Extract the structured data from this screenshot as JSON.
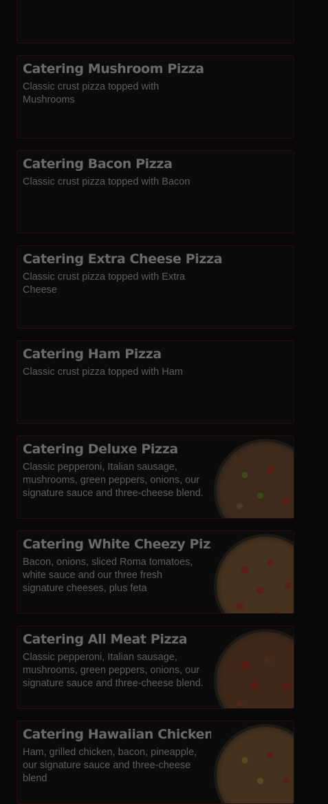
{
  "menu_items": [
    {
      "title": "",
      "description": ""
    },
    {
      "title": "Catering Mushroom Pizza",
      "description": "Classic crust pizza topped with Mushrooms"
    },
    {
      "title": "Catering Bacon Pizza",
      "description": "Classic crust pizza topped with Bacon"
    },
    {
      "title": "Catering Extra Cheese Pizza",
      "description": "Classic crust pizza topped with Extra Cheese"
    },
    {
      "title": "Catering Ham Pizza",
      "description": "Classic crust pizza topped with Ham"
    },
    {
      "title": "Catering Deluxe Pizza",
      "description": "Classic pepperoni, Italian sausage, mushrooms, green peppers, onions, our signature sauce and three-cheese blend.",
      "image": "deluxe-pizza-image"
    },
    {
      "title": "Catering White Cheezy Pizza",
      "description": "Bacon, onions, sliced Roma tomatoes, white sauce and our three fresh signature cheeses, plus feta",
      "image": "white-cheezy-pizza-image"
    },
    {
      "title": "Catering All Meat Pizza",
      "description": "Classic pepperoni, Italian sausage, mushrooms, green peppers, onions, our signature sauce and three-cheese blend.",
      "image": "all-meat-pizza-image"
    },
    {
      "title": "Catering Hawaiian Chicken",
      "description": "Ham, grilled chicken, bacon, pineapple, our signature sauce and three-cheese blend",
      "image": "hawaiian-chicken-pizza-image"
    }
  ],
  "colors": {
    "background": "#080808",
    "card_border": "#2a0d0d",
    "title_text": "#6a6a6a",
    "desc_text": "#5c5c5c"
  }
}
